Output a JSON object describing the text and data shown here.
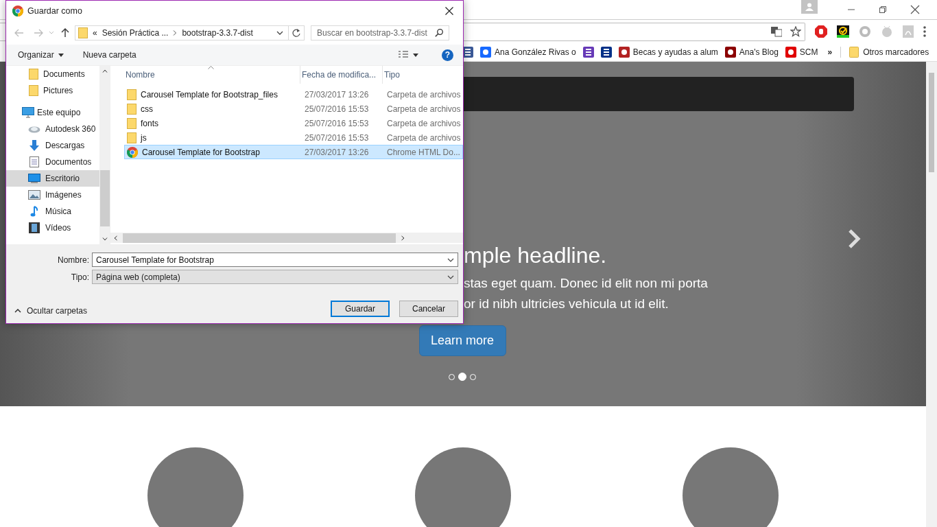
{
  "browser": {
    "bookmarks": [
      {
        "kind": "facebook"
      },
      {
        "label": "Ana González Rivas o",
        "kind": "behance"
      },
      {
        "kind": "list"
      },
      {
        "kind": "paypal"
      },
      {
        "label": "Becas y ayudas a alum",
        "kind": "crest"
      },
      {
        "label": "Ana's Blog",
        "kind": "ls"
      },
      {
        "label": "SCM",
        "kind": "scm"
      }
    ],
    "overflow": "»",
    "other_bookmarks": "Otros marcadores"
  },
  "page": {
    "headline": "mple headline.",
    "lines": [
      "stas eget quam. Donec id elit non mi porta",
      "or id nibh ultricies vehicula ut id elit."
    ],
    "button": "Learn more",
    "indicators": [
      {
        "selected": false
      },
      {
        "selected": true
      },
      {
        "selected": false
      }
    ]
  },
  "dialog": {
    "title": "Guardar como",
    "breadcrumb_prefix": "«",
    "breadcrumb": [
      "Sesión Práctica ...",
      "bootstrap-3.3.7-dist"
    ],
    "search": {
      "placeholder": "Buscar en bootstrap-3.3.7-dist"
    },
    "commands": [
      "Organizar",
      "Nueva carpeta"
    ],
    "help": "?",
    "sidebar": [
      {
        "label": "Documents",
        "kind": "folder",
        "selected": false
      },
      {
        "label": "Pictures",
        "kind": "folder",
        "selected": false
      },
      {
        "label": "Este equipo",
        "kind": "computer",
        "selected": false,
        "children": [
          {
            "label": "Autodesk 360",
            "kind": "cloud",
            "selected": false
          },
          {
            "label": "Descargas",
            "kind": "download",
            "selected": false
          },
          {
            "label": "Documentos",
            "kind": "document",
            "selected": false
          },
          {
            "label": "Escritorio",
            "kind": "desktop",
            "selected": true
          },
          {
            "label": "Imágenes",
            "kind": "image",
            "selected": false
          },
          {
            "label": "Música",
            "kind": "music",
            "selected": false
          },
          {
            "label": "Vídeos",
            "kind": "video",
            "selected": false
          }
        ]
      }
    ],
    "columns": [
      "Nombre",
      "Fecha de modifica...",
      "Tipo"
    ],
    "files": [
      {
        "name": "Carousel Template for Bootstrap_files",
        "kind": "folder",
        "date": "27/03/2017 13:26",
        "type": "Carpeta de archivos",
        "selected": false
      },
      {
        "name": "css",
        "kind": "folder",
        "date": "25/07/2016 15:53",
        "type": "Carpeta de archivos",
        "selected": false
      },
      {
        "name": "fonts",
        "kind": "folder",
        "date": "25/07/2016 15:53",
        "type": "Carpeta de archivos",
        "selected": false
      },
      {
        "name": "js",
        "kind": "folder",
        "date": "25/07/2016 15:53",
        "type": "Carpeta de archivos",
        "selected": false
      },
      {
        "name": "Carousel Template for Bootstrap",
        "kind": "chrome",
        "date": "27/03/2017 13:26",
        "type": "Chrome HTML Do...",
        "selected": true
      }
    ],
    "filename": {
      "label": "Nombre:",
      "value": "Carousel Template for Bootstrap"
    },
    "filetype": {
      "label": "Tipo:",
      "value": "Página web (completa)"
    },
    "hide_folders": "Ocultar carpetas",
    "buttons": [
      {
        "label": "Guardar",
        "default": true
      },
      {
        "label": "Cancelar",
        "default": false
      }
    ]
  }
}
